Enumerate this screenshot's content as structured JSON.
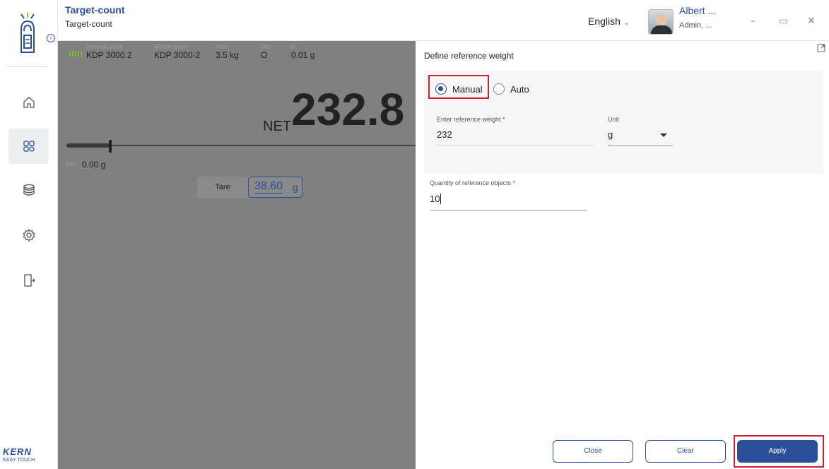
{
  "header": {
    "title": "Target-count",
    "subtitle": "Target-count",
    "language": "English",
    "user_name": "Albert ...",
    "user_role": "Admin, ..."
  },
  "brand": {
    "name": "KERN",
    "tagline": "EASY TOUCH"
  },
  "sidebar": {
    "items": [
      {
        "icon": "home-icon"
      },
      {
        "icon": "apps-icon",
        "active": true
      },
      {
        "icon": "database-icon"
      },
      {
        "icon": "settings-icon"
      },
      {
        "icon": "logout-icon"
      }
    ]
  },
  "device_info": [
    {
      "label": "Internal code",
      "value": "KDP 3000 2"
    },
    {
      "label": "Model name",
      "value": "KDP 3000-2"
    },
    {
      "label": "Max",
      "value": "3.5 kg"
    },
    {
      "label": "Min",
      "value": "O"
    },
    {
      "label": "d",
      "value": "0.01 g"
    }
  ],
  "weighing": {
    "net_label": "NET",
    "value": "232.8",
    "min_label": "Min",
    "min_value": "0.00 g",
    "tare_label": "Tare",
    "tare_value": "38.60",
    "tare_unit": "g"
  },
  "panel": {
    "title": "Define reference weight",
    "mode_options": [
      "Manual",
      "Auto"
    ],
    "selected_mode": "Manual",
    "ref_weight_label": "Enter reference weight",
    "ref_weight_value": "232",
    "unit_label": "Unit",
    "unit_value": "g",
    "quantity_label": "Quantity of reference objects",
    "quantity_value": "10",
    "required_mark": "*",
    "buttons": {
      "close": "Close",
      "clear": "Clear",
      "apply": "Apply"
    }
  },
  "colors": {
    "accent": "#2c4f9a",
    "highlight": "#d02030",
    "overlay": "#808080"
  }
}
